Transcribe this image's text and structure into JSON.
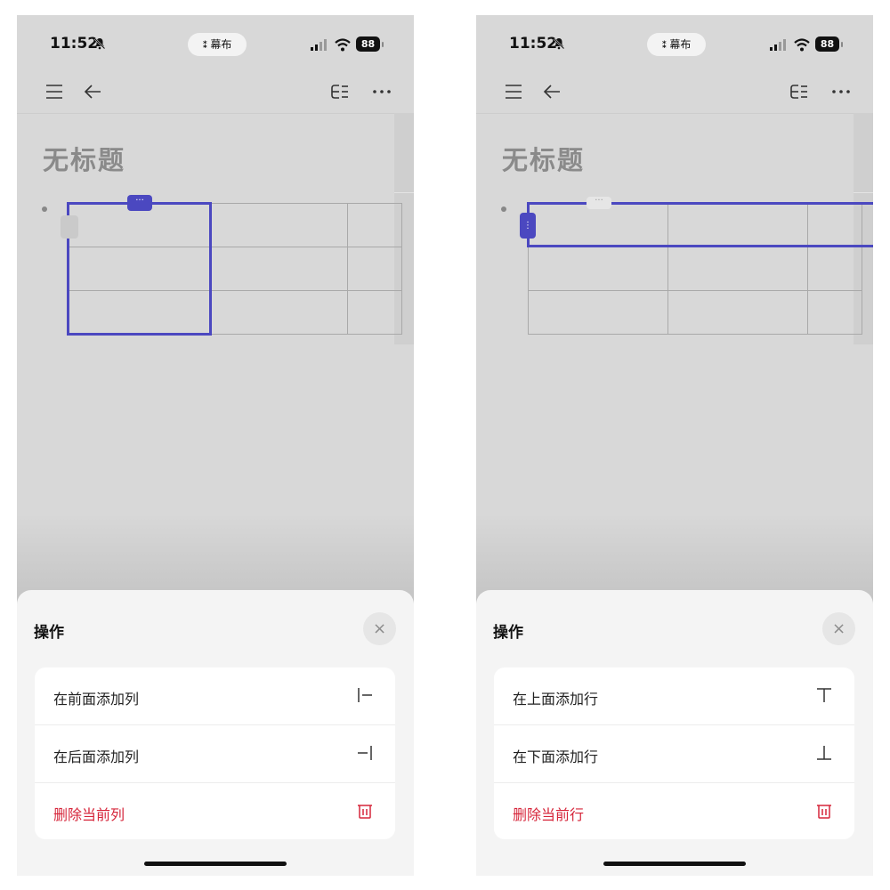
{
  "status_bar": {
    "time": "11:52",
    "pill_label": "幕布",
    "battery": "88"
  },
  "colors": {
    "accent": "#4b48c0",
    "danger": "#d6253a",
    "sheet_bg": "#f4f4f4"
  },
  "icons": [
    "bell-slash-icon",
    "menu-icon",
    "back-arrow-icon",
    "outline-icon",
    "more-icon",
    "close-icon",
    "insert-column-before-icon",
    "insert-column-after-icon",
    "insert-row-above-icon",
    "insert-row-below-icon",
    "trash-icon"
  ],
  "left_screen": {
    "doc_title": "无标题",
    "col_handle": "···",
    "sheet": {
      "title": "操作",
      "close": "×",
      "actions": [
        {
          "label": "在前面添加列",
          "icon": "insert-column-before-icon"
        },
        {
          "label": "在后面添加列",
          "icon": "insert-column-after-icon"
        },
        {
          "label": "删除当前列",
          "icon": "trash-icon",
          "danger": true
        }
      ]
    }
  },
  "right_screen": {
    "doc_title": "无标题",
    "col_handle": "···",
    "row_handle": "⋮",
    "sheet": {
      "title": "操作",
      "close": "×",
      "actions": [
        {
          "label": "在上面添加行",
          "icon": "insert-row-above-icon"
        },
        {
          "label": "在下面添加行",
          "icon": "insert-row-below-icon"
        },
        {
          "label": "删除当前行",
          "icon": "trash-icon",
          "danger": true
        }
      ]
    }
  }
}
